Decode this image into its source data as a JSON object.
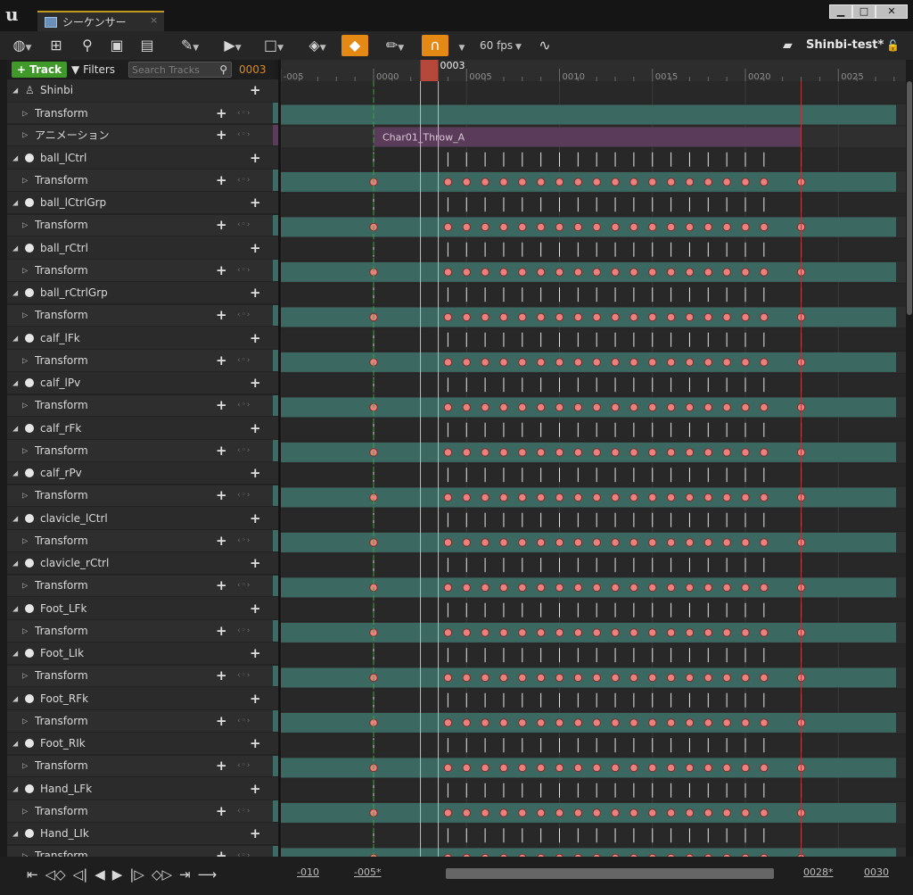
{
  "window": {
    "tab_label": "シーケンサー",
    "tab_close": "×",
    "min_label": "▁",
    "max_label": "□",
    "close_label": "✕"
  },
  "toolbar": {
    "fps_label": "60 fps",
    "sequence_name": "Shinbi-test*",
    "accent_color": "#e48a14"
  },
  "filterbar": {
    "add_track_label": "+ Track",
    "filters_label": "Filters",
    "search_placeholder": "Search Tracks",
    "current_frame": "0003"
  },
  "timeline": {
    "playhead_label": "0003",
    "ruler_ticks": [
      "-005",
      "0000",
      "0005",
      "0010",
      "0015",
      "0020",
      "0025"
    ],
    "range_labels": [
      "-010",
      "-005*",
      "0028*",
      "0030"
    ],
    "section_label": "Char01_Throw_A",
    "section_color": "#5b3b5a",
    "track_color": "#3c6862",
    "key_color": "#e9827e"
  },
  "tracks": [
    {
      "type": "actor",
      "label": "Shinbi"
    },
    {
      "type": "transform",
      "label": "Transform"
    },
    {
      "type": "animation",
      "label": "アニメーション"
    },
    {
      "type": "obj",
      "label": "ball_lCtrl"
    },
    {
      "type": "transform",
      "label": "Transform"
    },
    {
      "type": "obj",
      "label": "ball_lCtrlGrp"
    },
    {
      "type": "transform",
      "label": "Transform"
    },
    {
      "type": "obj",
      "label": "ball_rCtrl"
    },
    {
      "type": "transform",
      "label": "Transform"
    },
    {
      "type": "obj",
      "label": "ball_rCtrlGrp"
    },
    {
      "type": "transform",
      "label": "Transform"
    },
    {
      "type": "obj",
      "label": "calf_lFk"
    },
    {
      "type": "transform",
      "label": "Transform"
    },
    {
      "type": "obj",
      "label": "calf_lPv"
    },
    {
      "type": "transform",
      "label": "Transform"
    },
    {
      "type": "obj",
      "label": "calf_rFk"
    },
    {
      "type": "transform",
      "label": "Transform"
    },
    {
      "type": "obj",
      "label": "calf_rPv"
    },
    {
      "type": "transform",
      "label": "Transform"
    },
    {
      "type": "obj",
      "label": "clavicle_lCtrl"
    },
    {
      "type": "transform",
      "label": "Transform"
    },
    {
      "type": "obj",
      "label": "clavicle_rCtrl"
    },
    {
      "type": "transform",
      "label": "Transform"
    },
    {
      "type": "obj",
      "label": "Foot_LFk"
    },
    {
      "type": "transform",
      "label": "Transform"
    },
    {
      "type": "obj",
      "label": "Foot_LIk"
    },
    {
      "type": "transform",
      "label": "Transform"
    },
    {
      "type": "obj",
      "label": "Foot_RFk"
    },
    {
      "type": "transform",
      "label": "Transform"
    },
    {
      "type": "obj",
      "label": "Foot_RIk"
    },
    {
      "type": "transform",
      "label": "Transform"
    },
    {
      "type": "obj",
      "label": "Hand_LFk"
    },
    {
      "type": "transform",
      "label": "Transform"
    },
    {
      "type": "obj",
      "label": "Hand_LIk"
    },
    {
      "type": "transform",
      "label": "Transform"
    }
  ]
}
